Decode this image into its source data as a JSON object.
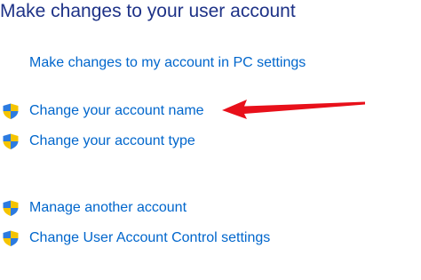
{
  "header": {
    "title": "Make changes to your user account"
  },
  "links": {
    "pc_settings": "Make changes to my account in PC settings"
  },
  "tasks": [
    {
      "label": "Change your account name",
      "icon": "uac-shield-icon"
    },
    {
      "label": "Change your account type",
      "icon": "uac-shield-icon"
    },
    {
      "label": "Manage another account",
      "icon": "uac-shield-icon"
    },
    {
      "label": "Change User Account Control settings",
      "icon": "uac-shield-icon"
    }
  ],
  "colors": {
    "title": "#1e3287",
    "link": "#0066cc",
    "annotation_arrow": "#e8101a"
  }
}
